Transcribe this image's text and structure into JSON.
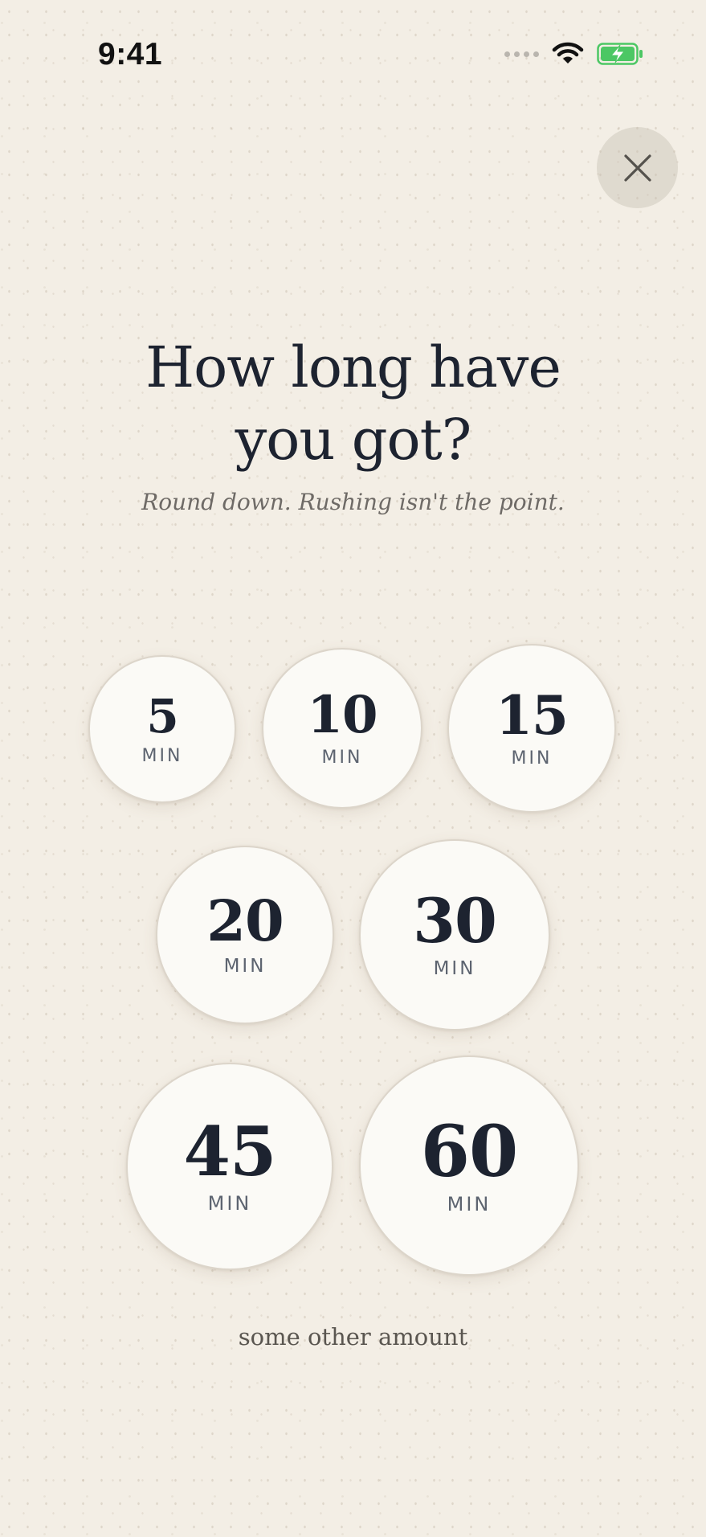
{
  "status_bar": {
    "time": "9:41",
    "wifi_icon": "wifi-icon",
    "battery_icon": "battery-charging-icon",
    "battery_color": "#4cc764"
  },
  "close_button": {
    "icon": "close-icon"
  },
  "header": {
    "title": "How long have you got?",
    "subtitle": "Round down. Rushing isn't the point."
  },
  "durations": [
    {
      "value": "5",
      "unit": "MIN"
    },
    {
      "value": "10",
      "unit": "MIN"
    },
    {
      "value": "15",
      "unit": "MIN"
    },
    {
      "value": "20",
      "unit": "MIN"
    },
    {
      "value": "30",
      "unit": "MIN"
    },
    {
      "value": "45",
      "unit": "MIN"
    },
    {
      "value": "60",
      "unit": "MIN"
    }
  ],
  "other_amount_label": "some other amount",
  "colors": {
    "background": "#f3eee5",
    "text_primary": "#1d2330",
    "circle_fill": "#fbfaf6"
  }
}
